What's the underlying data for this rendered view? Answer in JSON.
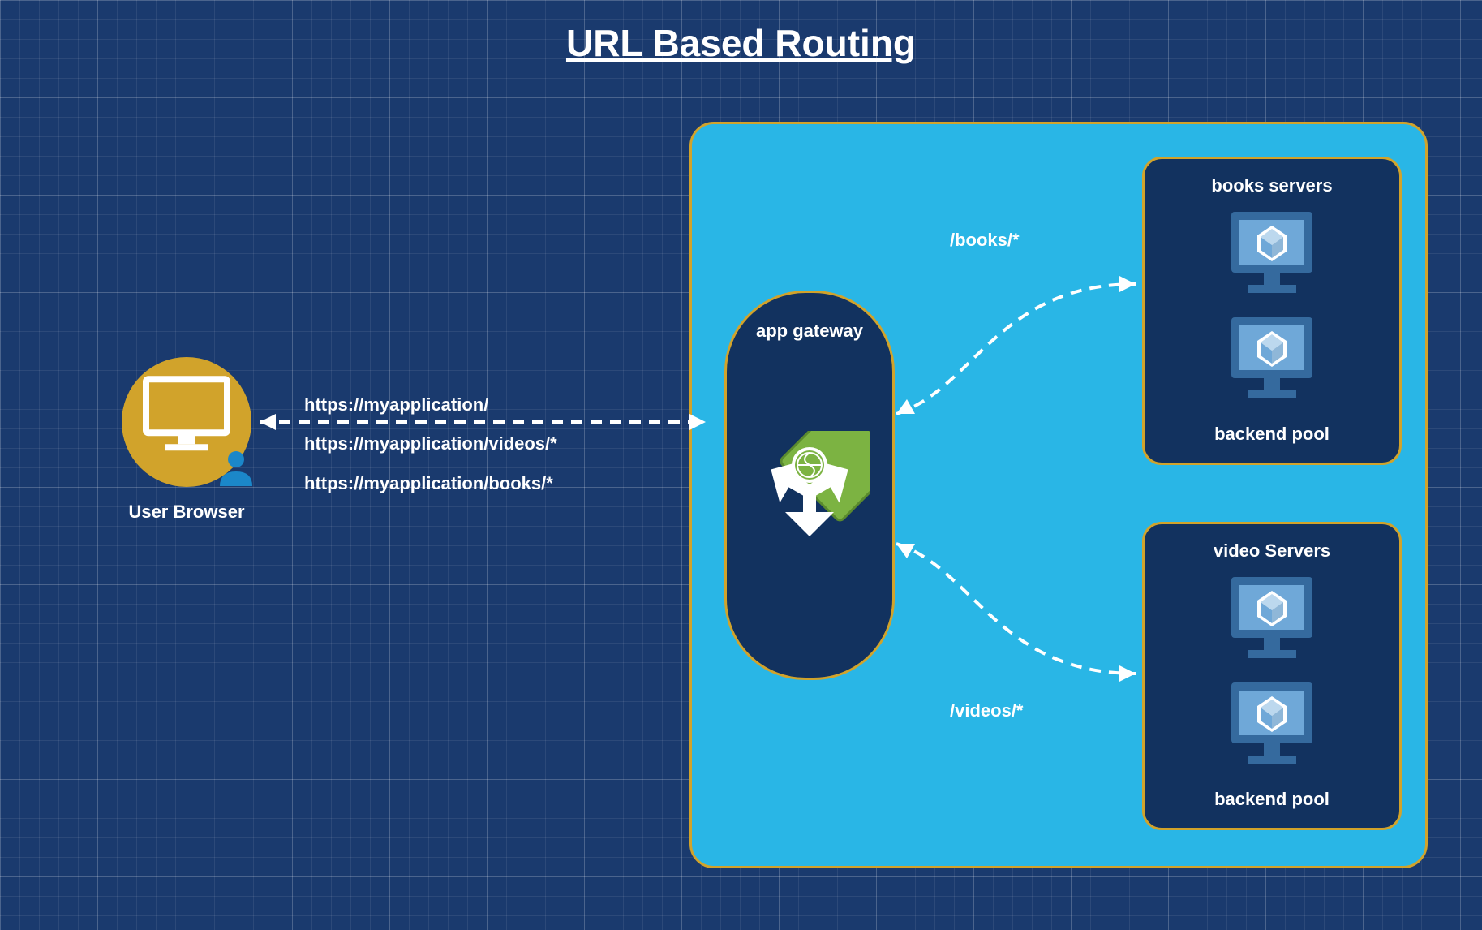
{
  "title": "URL Based Routing",
  "user": {
    "label": "User Browser"
  },
  "urls": {
    "base": "https://myapplication/",
    "videos": "https://myapplication/videos/*",
    "books": "https://myapplication/books/*"
  },
  "gateway": {
    "label": "app gateway"
  },
  "routes": {
    "books": "/books/*",
    "videos": "/videos/*"
  },
  "pools": {
    "books": {
      "title": "books servers",
      "footer": "backend pool"
    },
    "videos": {
      "title": "video Servers",
      "footer": "backend pool"
    }
  },
  "colors": {
    "accent": "#d1a32b",
    "panel": "#12325f",
    "cloud": "#29b6e6",
    "green": "#7cb342",
    "blue": "#356a9e",
    "lightblue": "#6fa8d8"
  }
}
